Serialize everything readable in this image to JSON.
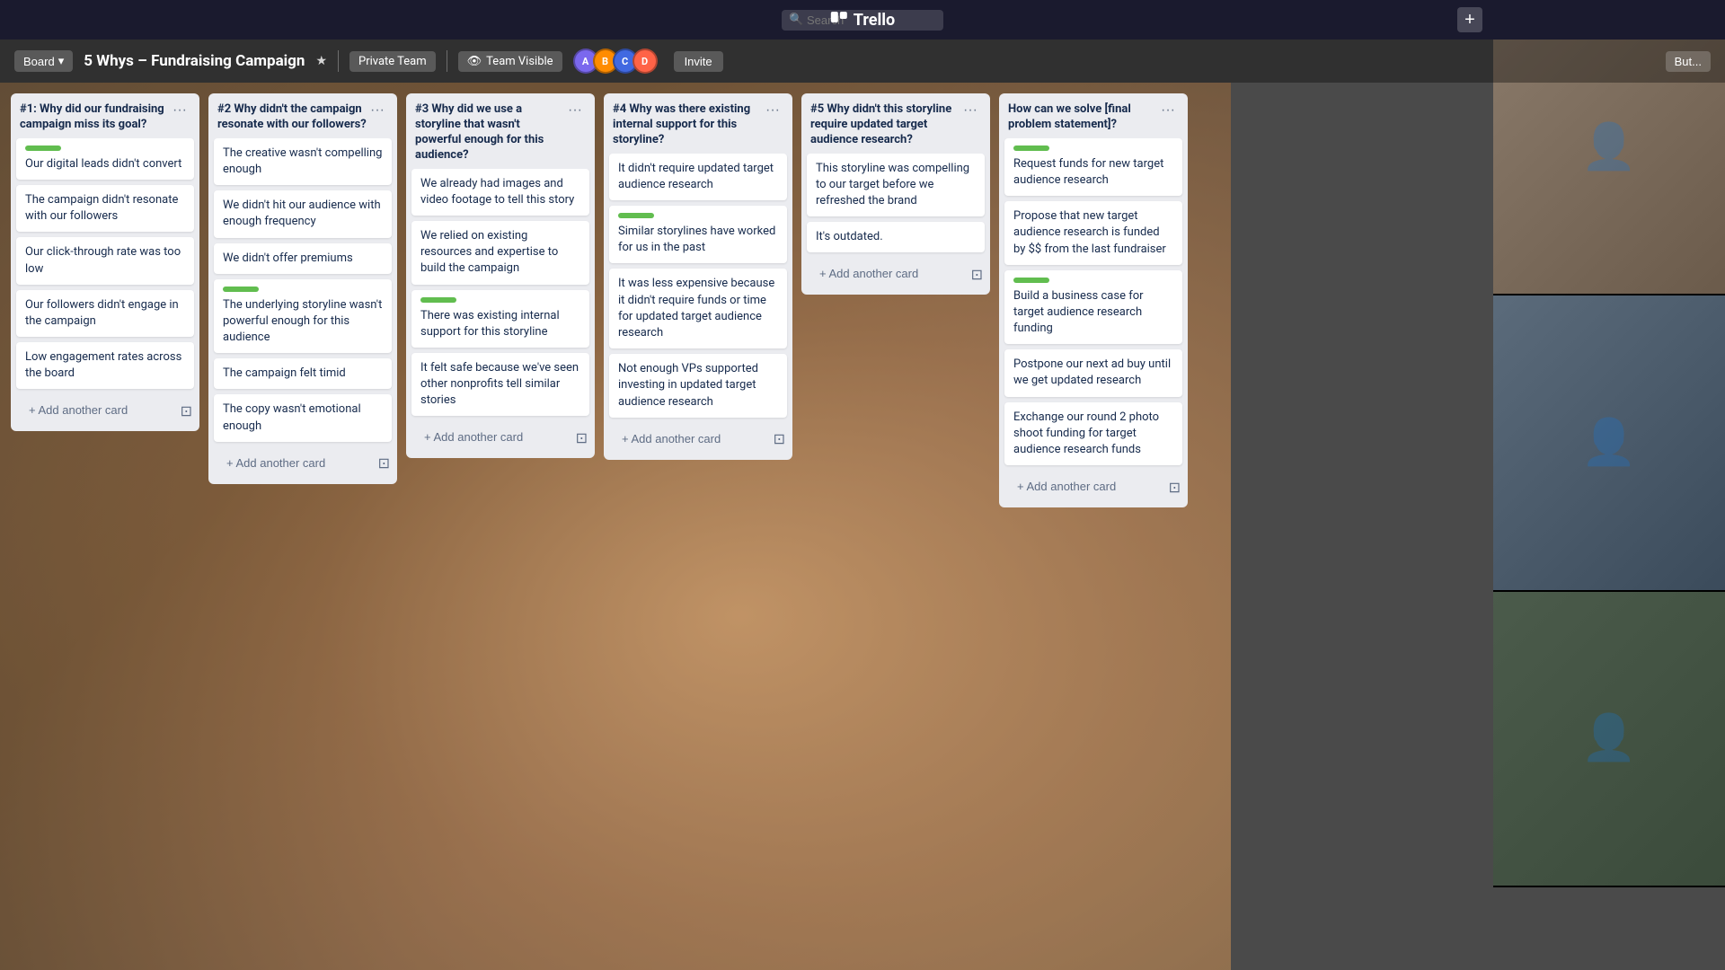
{
  "topbar": {
    "search_placeholder": "Search",
    "logo": "Trello",
    "add_label": "+"
  },
  "board_header": {
    "board_label": "Board",
    "title": "5 Whys – Fundraising Campaign",
    "team": "Private Team",
    "visibility": "Team Visible",
    "invite_label": "Invite",
    "butler_label": "But..."
  },
  "lists": [
    {
      "id": "list1",
      "title": "#1: Why did our fundraising campaign miss its goal?",
      "cards": [
        {
          "id": "c1",
          "text": "Our digital leads didn't convert",
          "label": "green"
        },
        {
          "id": "c2",
          "text": "The campaign didn't resonate with our followers",
          "label": null
        },
        {
          "id": "c3",
          "text": "Our click-through rate was too low",
          "label": null
        },
        {
          "id": "c4",
          "text": "Our followers didn't engage in the campaign",
          "label": null
        },
        {
          "id": "c5",
          "text": "Low engagement rates across the board",
          "label": null
        }
      ],
      "add_label": "+ Add another card"
    },
    {
      "id": "list2",
      "title": "#2 Why didn't the campaign resonate with our followers?",
      "cards": [
        {
          "id": "c6",
          "text": "The creative wasn't compelling enough",
          "label": null
        },
        {
          "id": "c7",
          "text": "We didn't hit our audience with enough frequency",
          "label": null
        },
        {
          "id": "c8",
          "text": "We didn't offer premiums",
          "label": null
        },
        {
          "id": "c9",
          "text": "The underlying storyline wasn't powerful enough for this audience",
          "label": "green"
        },
        {
          "id": "c10",
          "text": "The campaign felt timid",
          "label": null
        },
        {
          "id": "c11",
          "text": "The copy wasn't emotional enough",
          "label": null
        }
      ],
      "add_label": "+ Add another card"
    },
    {
      "id": "list3",
      "title": "#3 Why did we use a storyline that wasn't powerful enough for this audience?",
      "cards": [
        {
          "id": "c12",
          "text": "We already had images and video footage to tell this story",
          "label": null
        },
        {
          "id": "c13",
          "text": "We relied on existing resources and expertise to build the campaign",
          "label": null
        },
        {
          "id": "c14",
          "text": "There was existing internal support for this storyline",
          "label": "green"
        },
        {
          "id": "c15",
          "text": "It felt safe because we've seen other nonprofits tell similar stories",
          "label": null
        }
      ],
      "add_label": "+ Add another card"
    },
    {
      "id": "list4",
      "title": "#4 Why was there existing internal support for this storyline?",
      "cards": [
        {
          "id": "c16",
          "text": "It didn't require updated target audience research",
          "label": null
        },
        {
          "id": "c17",
          "text": "Similar storylines have worked for us in the past",
          "label": "green"
        },
        {
          "id": "c18",
          "text": "It was less expensive because it didn't require funds or time for updated target audience research",
          "label": null
        },
        {
          "id": "c19",
          "text": "Not enough VPs supported investing in updated target audience research",
          "label": null
        }
      ],
      "add_label": "+ Add another card"
    },
    {
      "id": "list5",
      "title": "#5 Why didn't this storyline require updated target audience research?",
      "cards": [
        {
          "id": "c20",
          "text": "This storyline was compelling to our target before we refreshed the brand",
          "label": null
        },
        {
          "id": "c21",
          "text": "It's outdated.",
          "label": null
        }
      ],
      "add_label": "+ Add another card"
    },
    {
      "id": "list6",
      "title": "How can we solve [final problem statement]?",
      "cards": [
        {
          "id": "c22",
          "text": "Request funds for new target audience research",
          "label": "green"
        },
        {
          "id": "c23",
          "text": "Propose that new target audience research is funded by $$ from the last fundraiser",
          "label": null
        },
        {
          "id": "c24",
          "text": "Build a business case for target audience research funding",
          "label": "green"
        },
        {
          "id": "c25",
          "text": "Postpone our next ad buy until we get updated research",
          "label": null
        },
        {
          "id": "c26",
          "text": "Exchange our round 2 photo shoot funding for target audience research funds",
          "label": null
        }
      ],
      "add_label": "+ Add another card"
    }
  ],
  "avatars": [
    {
      "color": "#7B68EE",
      "initials": "A"
    },
    {
      "color": "#FF8C00",
      "initials": "B"
    },
    {
      "color": "#4169E1",
      "initials": "C"
    },
    {
      "color": "#FF6347",
      "initials": "D"
    }
  ],
  "icons": {
    "search": "🔍",
    "star": "★",
    "dots": "···",
    "plus": "+",
    "pencil": "✎",
    "eye": "👁",
    "card_template": "⊡"
  }
}
